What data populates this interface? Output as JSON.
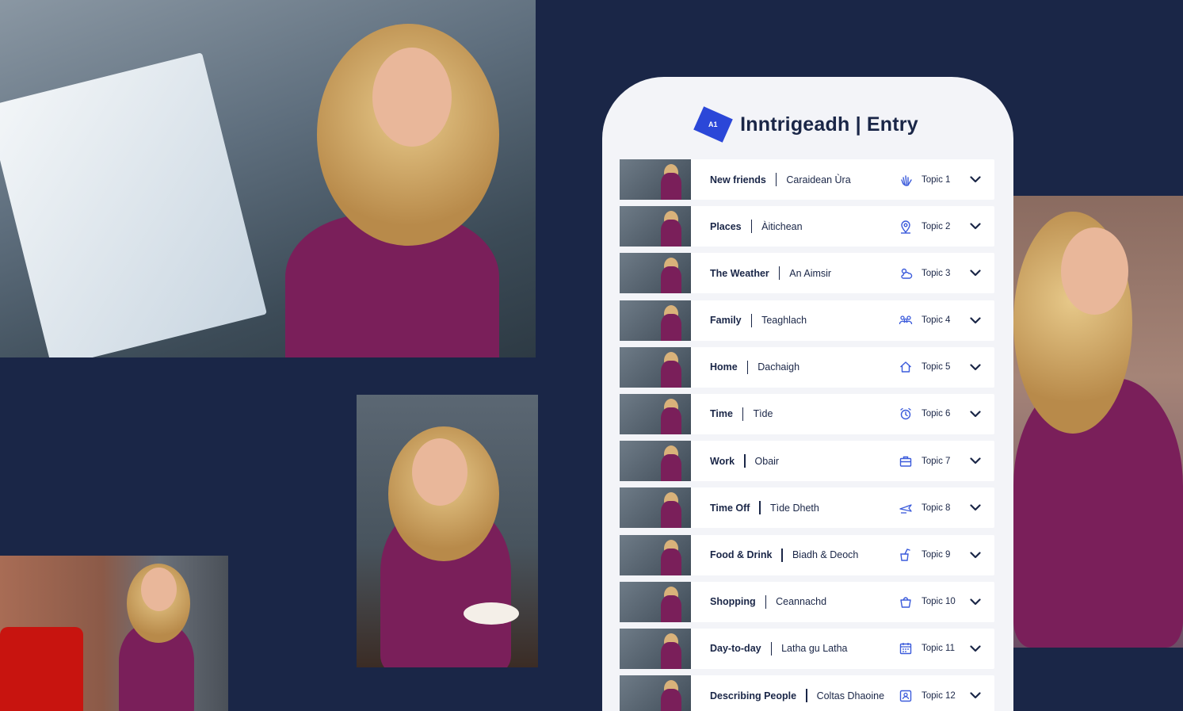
{
  "header": {
    "level_badge": "A1",
    "title": "Inntrigeadh | Entry"
  },
  "colors": {
    "background": "#1a2647",
    "card": "#f3f4f8",
    "accent": "#2b47d8",
    "icon": "#3b5bdb"
  },
  "topics": [
    {
      "en": "New friends",
      "gd": "Caraidean Ùra",
      "topic": "Topic 1",
      "icon": "wave-hand-icon"
    },
    {
      "en": "Places",
      "gd": "Àitichean",
      "topic": "Topic 2",
      "icon": "map-pin-icon"
    },
    {
      "en": "The Weather",
      "gd": "An Aimsir",
      "topic": "Topic 3",
      "icon": "sun-cloud-icon"
    },
    {
      "en": "Family",
      "gd": "Teaghlach",
      "topic": "Topic 4",
      "icon": "people-icon"
    },
    {
      "en": "Home",
      "gd": "Dachaigh",
      "topic": "Topic 5",
      "icon": "house-icon"
    },
    {
      "en": "Time",
      "gd": "Tìde",
      "topic": "Topic 6",
      "icon": "alarm-clock-icon"
    },
    {
      "en": "Work",
      "gd": "Obair",
      "topic": "Topic 7",
      "icon": "briefcase-icon"
    },
    {
      "en": "Time Off",
      "gd": "Tìde Dheth",
      "topic": "Topic 8",
      "icon": "plane-icon"
    },
    {
      "en": "Food & Drink",
      "gd": "Biadh & Deoch",
      "topic": "Topic 9",
      "icon": "drink-icon"
    },
    {
      "en": "Shopping",
      "gd": "Ceannachd",
      "topic": "Topic 10",
      "icon": "shopping-bag-icon"
    },
    {
      "en": "Day-to-day",
      "gd": "Latha gu Latha",
      "topic": "Topic 11",
      "icon": "calendar-icon"
    },
    {
      "en": "Describing People",
      "gd": "Coltas Dhaoine",
      "topic": "Topic 12",
      "icon": "person-card-icon"
    }
  ]
}
